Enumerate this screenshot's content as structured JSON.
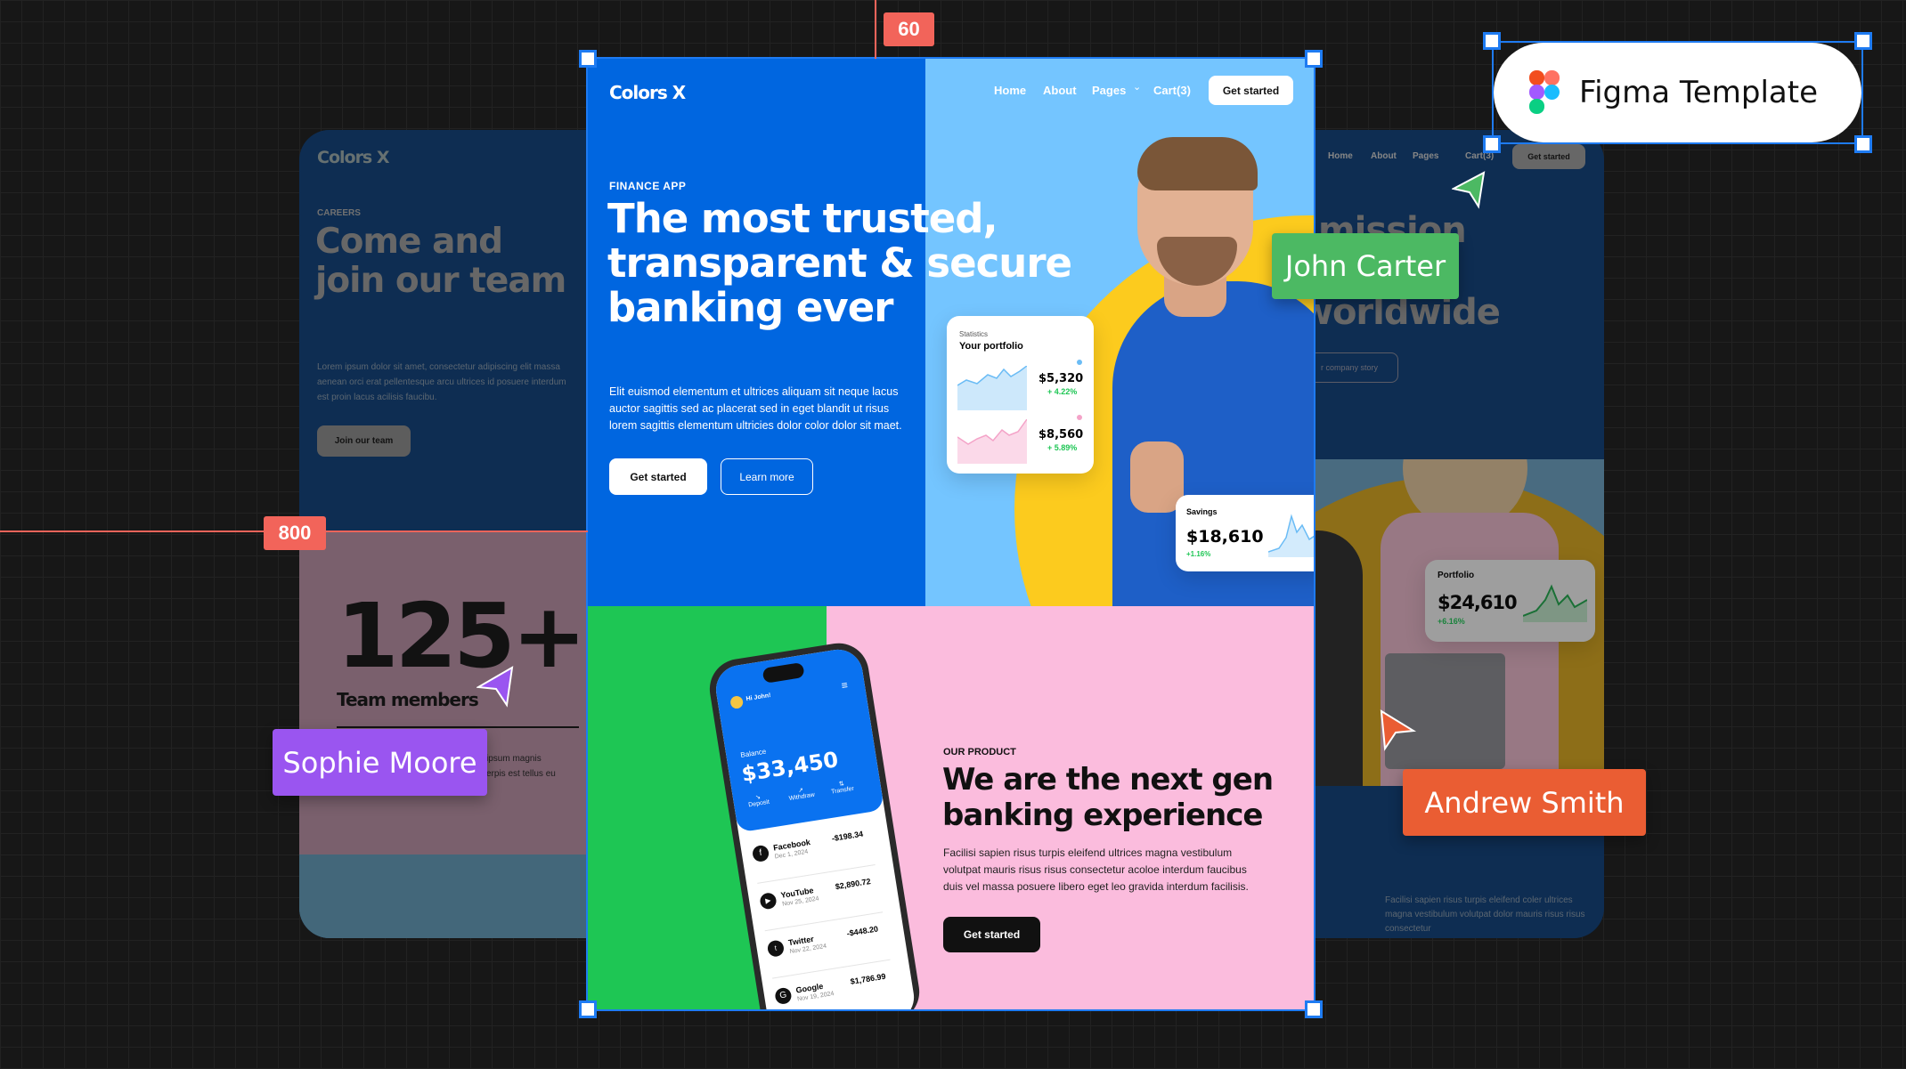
{
  "guides": {
    "top_label": "60",
    "left_label": "800"
  },
  "figma_badge": {
    "label": "Figma Template"
  },
  "collaborators": [
    {
      "name": "John Carter",
      "color": "#4cb963"
    },
    {
      "name": "Sophie Moore",
      "color": "#9a55f0"
    },
    {
      "name": "Andrew Smith",
      "color": "#ea5d33"
    }
  ],
  "left_page": {
    "logo": "Colors X",
    "eyebrow": "CAREERS",
    "headline_1": "Come and",
    "headline_2": "join our team",
    "body": "Lorem ipsum dolor sit amet, consectetur adipiscing elit massa aenean orci erat pellentesque arcu ultrices id posuere interdum est proin lacus acilisis faucibu.",
    "button": "Join our team",
    "stat": "125+",
    "stat_label": "Team members",
    "stat_text_1": "ipsum magnis",
    "stat_text_2": "erpis est tellus eu"
  },
  "right_page": {
    "nav": [
      "Home",
      "About",
      "Pages",
      "Cart(3)"
    ],
    "button": "Get started",
    "headline_1": "mission",
    "headline_2": "worldwide",
    "story_button": "r company story",
    "portfolio_label": "Portfolio",
    "portfolio_value": "$24,610",
    "portfolio_change": "+6.16%",
    "body": "Facilisi sapien risus turpis eleifend coler ultrices magna vestibulum volutpat dolor mauris risus risus consectetur"
  },
  "main_page": {
    "logo": "Colors X",
    "nav": {
      "home": "Home",
      "about": "About",
      "pages": "Pages",
      "cart": "Cart(3)",
      "cta": "Get started"
    },
    "hero": {
      "eyebrow": "FINANCE APP",
      "headline_1": "The most trusted,",
      "headline_2": "transparent & secure",
      "headline_3": "banking ever",
      "body_1": "Elit euismod elementum et ultrices aliquam sit neque lacus",
      "body_2": "auctor sagittis sed ac placerat sed in eget blandit ut risus",
      "body_3": "lorem sagittis elementum ultricies dolor color dolor sit maet.",
      "primary": "Get started",
      "secondary": "Learn more"
    },
    "stats_card": {
      "label": "Statistics",
      "title": "Your portfolio",
      "value_1": "$5,320",
      "change_1": "+ 4.22%",
      "value_2": "$8,560",
      "change_2": "+ 5.89%"
    },
    "savings_card": {
      "label": "Savings",
      "value": "$18,610",
      "change": "+1.16%"
    },
    "product": {
      "eyebrow": "OUR PRODUCT",
      "headline_1": "We are the next gen",
      "headline_2": "banking experience",
      "body_1": "Facilisi sapien risus turpis eleifend ultrices magna vestibulum",
      "body_2": "volutpat mauris risus risus consectetur acoloe interdum faucibus",
      "body_3": "duis vel massa posuere libero eget leo gravida interdum facilisis.",
      "button": "Get started"
    },
    "phone": {
      "greeting": "Hi John!",
      "balance_label": "Balance",
      "balance": "$33,450",
      "actions": [
        "Deposit",
        "Withdraw",
        "Transfer"
      ],
      "transactions": [
        {
          "name": "Facebook",
          "date": "Dec 1, 2024",
          "amount": "-$198.34"
        },
        {
          "name": "YouTube",
          "date": "Nov 25, 2024",
          "amount": "$2,890.72"
        },
        {
          "name": "Twitter",
          "date": "Nov 22, 2024",
          "amount": "-$448.20"
        },
        {
          "name": "Google",
          "date": "Nov 19, 2024",
          "amount": "$1,786.99"
        }
      ]
    }
  },
  "colors": {
    "hero_blue": "#0066e0",
    "hero_light": "#74c5ff",
    "yellow": "#fccb1e",
    "green": "#1ec654",
    "pink": "#fbbcdd",
    "selection": "#1e7bf2",
    "guide": "#f2645a"
  }
}
